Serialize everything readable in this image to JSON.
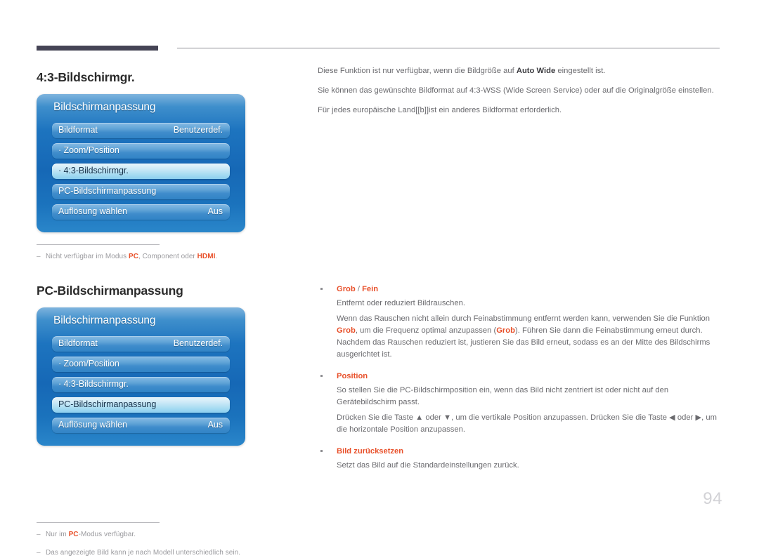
{
  "page": {
    "number": "94"
  },
  "sections": [
    {
      "title": "4:3-Bildschirmgr.",
      "menu": {
        "title": "Bildschirmanpassung",
        "rows": [
          {
            "label": "Bildformat",
            "value": "Benutzerdef.",
            "selected": false
          },
          {
            "label": "· Zoom/Position",
            "value": "",
            "selected": false
          },
          {
            "label": "· 4:3-Bildschirmgr.",
            "value": "",
            "selected": true
          },
          {
            "label": "PC-Bildschirmanpassung",
            "value": "",
            "selected": false
          },
          {
            "label": "Auflösung wählen",
            "value": "Aus",
            "selected": false
          }
        ]
      },
      "footnotes": [
        {
          "pre": "Nicht verfügbar im Modus ",
          "kw1": "PC",
          "mid": ", Component oder ",
          "kw2": "HDMI",
          "post": "."
        }
      ]
    },
    {
      "title": "PC-Bildschirmanpassung",
      "menu": {
        "title": "Bildschirmanpassung",
        "rows": [
          {
            "label": "Bildformat",
            "value": "Benutzerdef.",
            "selected": false
          },
          {
            "label": "· Zoom/Position",
            "value": "",
            "selected": false
          },
          {
            "label": "· 4:3-Bildschirmgr.",
            "value": "",
            "selected": false
          },
          {
            "label": "PC-Bildschirmanpassung",
            "value": "",
            "selected": true
          },
          {
            "label": "Auflösung wählen",
            "value": "Aus",
            "selected": false
          }
        ]
      },
      "footnotes": [
        {
          "pre": "Nur im ",
          "kw1": "PC",
          "mid": "-Modus verfügbar.",
          "kw2": "",
          "post": ""
        },
        {
          "pre": "Das angezeigte Bild kann je nach Modell unterschiedlich sein.",
          "kw1": "",
          "mid": "",
          "kw2": "",
          "post": ""
        }
      ]
    }
  ],
  "intro": {
    "line1_a": "Diese Funktion ist nur verfügbar, wenn die Bildgröße auf ",
    "line1_b": "Auto Wide",
    "line1_c": " eingestellt ist.",
    "line2": "Sie können das gewünschte Bildformat auf 4:3-WSS (Wide Screen Service) oder auf die Originalgröße einstellen.",
    "line3": "Für jedes europäische Land[[b]]ist ein anderes Bildformat erforderlich."
  },
  "bullets": [
    {
      "head_a": "Grob",
      "head_sep": " / ",
      "head_b": "Fein",
      "paras": [
        {
          "t1": "Entfernt oder reduziert Bildrauschen.",
          "kw1": "",
          "t2": "",
          "kw2": "",
          "t3": ""
        },
        {
          "t1": "Wenn das Rauschen nicht allein durch Feinabstimmung entfernt werden kann, verwenden Sie die Funktion ",
          "kw1": "Grob",
          "t2": ", um die Frequenz optimal anzupassen (",
          "kw2": "Grob",
          "t3": "). Führen Sie dann die Feinabstimmung erneut durch. Nachdem das Rauschen reduziert ist, justieren Sie das Bild erneut, sodass es an der Mitte des Bildschirms ausgerichtet ist."
        }
      ]
    },
    {
      "head_a": "Position",
      "head_sep": "",
      "head_b": "",
      "paras": [
        {
          "t1": "So stellen Sie die PC-Bildschirmposition ein, wenn das Bild nicht zentriert ist oder nicht auf den Gerätebildschirm passt.",
          "kw1": "",
          "t2": "",
          "kw2": "",
          "t3": ""
        },
        {
          "t1": "Drücken Sie die Taste ▲ oder ▼, um die vertikale Position anzupassen. Drücken Sie die Taste ◀ oder ▶, um die horizontale Position anzupassen.",
          "kw1": "",
          "t2": "",
          "kw2": "",
          "t3": ""
        }
      ]
    },
    {
      "head_a": "Bild zurücksetzen",
      "head_sep": "",
      "head_b": "",
      "paras": [
        {
          "t1": "Setzt das Bild auf die Standardeinstellungen zurück.",
          "kw1": "",
          "t2": "",
          "kw2": "",
          "t3": ""
        }
      ]
    }
  ],
  "colors": {
    "accent": "#e8502a",
    "rule_dark": "#454455",
    "panel_blue": "#1668b6"
  }
}
